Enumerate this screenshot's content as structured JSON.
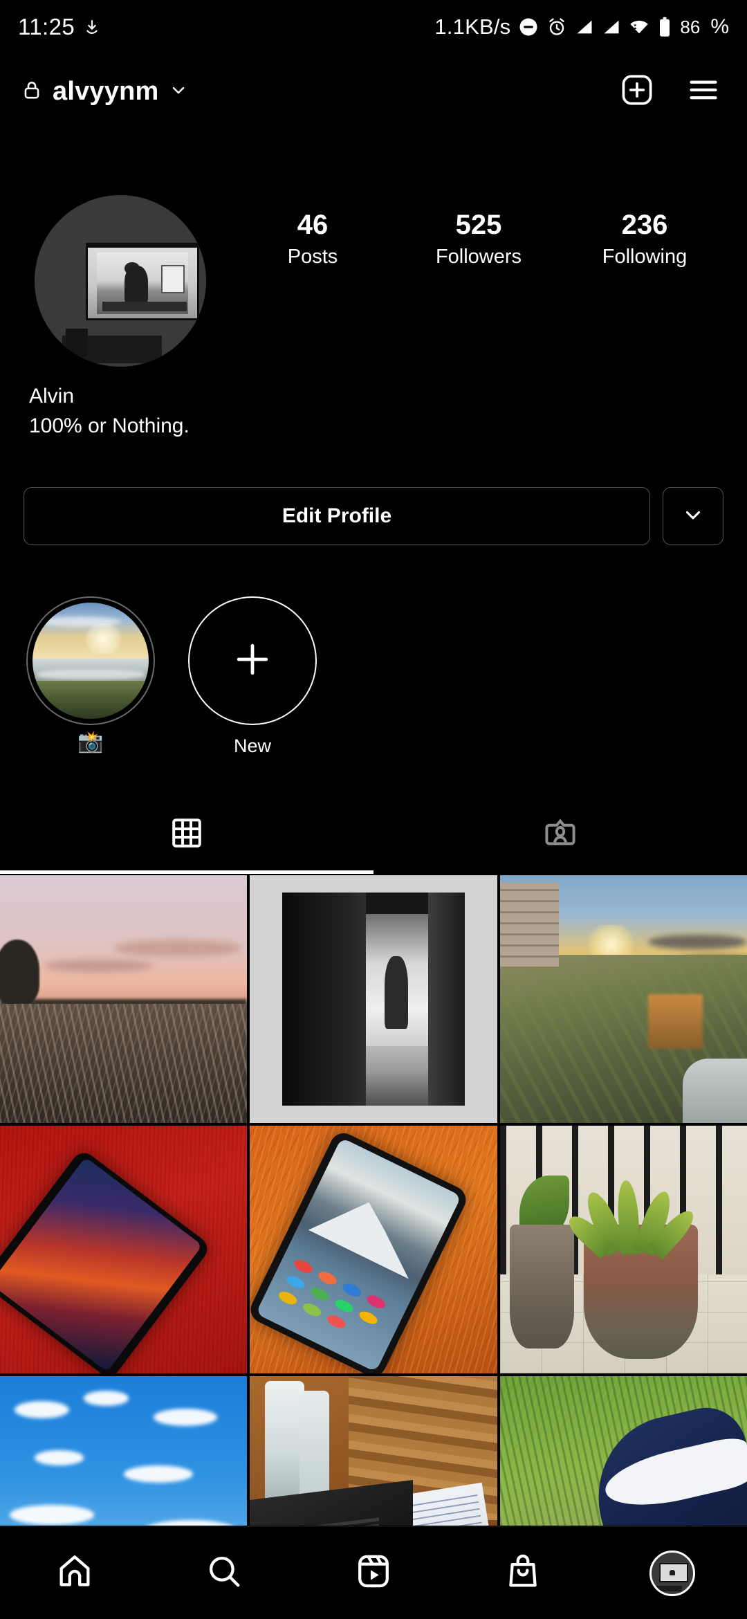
{
  "statusbar": {
    "time": "11:25",
    "download_icon": "download-arrow-icon",
    "net_speed": "1.1KB/s",
    "dnd_icon": "do-not-disturb-icon",
    "alarm_icon": "alarm-clock-icon",
    "signal1_icon": "signal-bars-icon",
    "signal2_icon": "signal-bars-icon",
    "wifi_icon": "wifi-icon",
    "battery_icon": "battery-icon",
    "battery_level": "86",
    "battery_symbol": "%"
  },
  "header": {
    "lock_icon": "lock-icon",
    "username": "alvyynm",
    "chevron_icon": "chevron-down-icon",
    "create_icon": "plus-square-icon",
    "menu_icon": "hamburger-menu-icon"
  },
  "profile": {
    "avatar_name": "profile-avatar",
    "stats": [
      {
        "value": "46",
        "label": "Posts"
      },
      {
        "value": "525",
        "label": "Followers"
      },
      {
        "value": "236",
        "label": "Following"
      }
    ],
    "display_name": "Alvin",
    "bio": "100% or Nothing."
  },
  "actions": {
    "edit_profile_label": "Edit Profile",
    "more_icon": "chevron-down-icon"
  },
  "highlights": {
    "items": [
      {
        "label": "📸",
        "cover": "beach-sunset-cover",
        "type": "highlight"
      }
    ],
    "new_label": "New",
    "new_icon": "plus-icon"
  },
  "tabs": [
    {
      "name": "grid",
      "icon": "grid-icon",
      "active": true
    },
    {
      "name": "tagged",
      "icon": "tagged-person-icon",
      "active": false
    }
  ],
  "grid_posts": [
    {
      "alt": "sunset-field"
    },
    {
      "alt": "bw-corridor"
    },
    {
      "alt": "cliff-sunset"
    },
    {
      "alt": "phone-on-red-cloth"
    },
    {
      "alt": "phone-on-orange-cloth"
    },
    {
      "alt": "potted-plants-balcony"
    },
    {
      "alt": "blue-sky-clouds-buildings"
    },
    {
      "alt": "laptop-notebook-desk"
    },
    {
      "alt": "blue-sneaker-grass"
    }
  ],
  "bottomnav": [
    {
      "name": "home",
      "icon": "home-icon",
      "active": false
    },
    {
      "name": "search",
      "icon": "search-icon",
      "active": false
    },
    {
      "name": "reels",
      "icon": "reels-icon",
      "active": false
    },
    {
      "name": "shop",
      "icon": "shop-bag-icon",
      "active": false
    },
    {
      "name": "profile",
      "icon": "profile-avatar-icon",
      "active": true
    }
  ],
  "colors": {
    "background": "#000000",
    "text": "#ffffff",
    "border": "#515151",
    "muted": "#8e8e8e"
  }
}
